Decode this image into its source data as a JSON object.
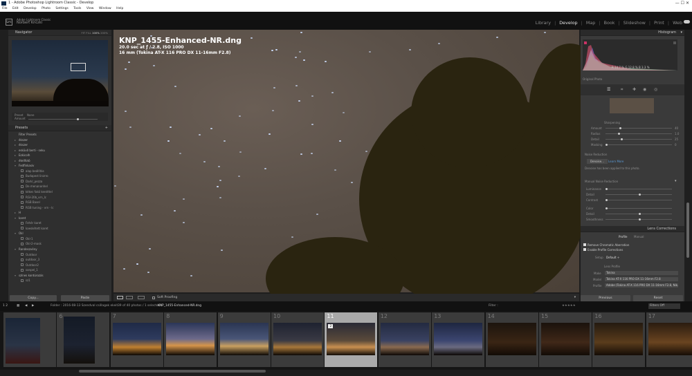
{
  "window": {
    "title": "1 - Adobe Photoshop Lightroom Classic - Develop",
    "controls": "—   ☐   ✕"
  },
  "menu": [
    "File",
    "Edit",
    "Develop",
    "Photo",
    "Settings",
    "Tools",
    "View",
    "Window",
    "Help"
  ],
  "identity": {
    "logo": "Lrc",
    "line1": "Adobe Lightroom Classic",
    "line2": "Norbert Kriczki"
  },
  "modules": {
    "library": "Library",
    "develop": "Develop",
    "map": "Map",
    "book": "Book",
    "slideshow": "Slideshow",
    "print": "Print",
    "web": "Web",
    "sep": "|"
  },
  "navigator": {
    "title": "Navigator",
    "zoom_fit": "FIT",
    "zoom_fill": "FILL",
    "zoom_100": "100%",
    "zoom_200": "200%",
    "preset_tab": "Preset",
    "none_tab": "None",
    "amount": "Amount"
  },
  "presets": {
    "title": "Presets",
    "plus": "+",
    "items": [
      {
        "type": "f",
        "label": "Filter Presets"
      },
      {
        "type": "f",
        "label": "ékszer",
        "arrow": "▸"
      },
      {
        "type": "f",
        "label": "ékszer",
        "arrow": "▸"
      },
      {
        "type": "f",
        "label": "esküvő berti - seku",
        "arrow": "▸"
      },
      {
        "type": "f",
        "label": "Ezkicolh",
        "arrow": "▸"
      },
      {
        "type": "f",
        "label": "étellfotó",
        "arrow": "▸"
      },
      {
        "type": "f",
        "label": "Fedfinkasiv",
        "arrow": "▾"
      },
      {
        "type": "i",
        "label": "alap beállítás"
      },
      {
        "type": "i",
        "label": "Budapest linzrro"
      },
      {
        "type": "i",
        "label": "Darkl_pezza"
      },
      {
        "type": "i",
        "label": "De menanonhel"
      },
      {
        "type": "i",
        "label": "kékes fakó kenéttel"
      },
      {
        "type": "i",
        "label": "RGI-20b_vrn_lc"
      },
      {
        "type": "i",
        "label": "RGB Basel"
      },
      {
        "type": "i",
        "label": "RGB tuning - vrn - lc"
      },
      {
        "type": "f",
        "label": "H",
        "arrow": "▸"
      },
      {
        "type": "f",
        "label": "karet",
        "arrow": "▾"
      },
      {
        "type": "i",
        "label": "Fehér karet"
      },
      {
        "type": "i",
        "label": "kaeskétett karet"
      },
      {
        "type": "f",
        "label": "Okl",
        "arrow": "▾"
      },
      {
        "type": "i",
        "label": "Okl-1"
      },
      {
        "type": "i",
        "label": "Okl-2-mask"
      },
      {
        "type": "f",
        "label": "Randeszvény",
        "arrow": "▾"
      },
      {
        "type": "i",
        "label": "Outdoor"
      },
      {
        "type": "i",
        "label": "outdoor_3"
      },
      {
        "type": "i",
        "label": "Outdoor2"
      },
      {
        "type": "i",
        "label": "sonpel_1"
      },
      {
        "type": "f",
        "label": "színes kontúrozás",
        "arrow": "▾"
      },
      {
        "type": "i",
        "label": "sz1"
      }
    ]
  },
  "left_buttons": {
    "copy": "Copy...",
    "paste": "Paste"
  },
  "photo": {
    "filename": "KNP_1455-Enhanced-NR.dng",
    "exposure": "20.0 sec at ƒ / 2.8, ISO 1000",
    "lens": "16 mm (Tokina AT-X 116 PRO DX 11-16mm F2.8)"
  },
  "toolbar": {
    "soft_proofing": "Soft Proofing"
  },
  "histogram": {
    "title": "Histogram",
    "r_label": "R",
    "r": "14.7",
    "g_label": "G",
    "g": "12.8",
    "b_label": "B",
    "b": "3.3",
    "pct": "%",
    "original": "Original Photo"
  },
  "detail": {
    "sharpening": "Sharpening",
    "amount": "Amount",
    "amount_v": "40",
    "radius": "Radius",
    "radius_v": "1.0",
    "detail": "Detail",
    "detail_v": "25",
    "masking": "Masking",
    "masking_v": "0",
    "nr": "Noise Reduction",
    "nr_denoise": "Denoise...",
    "nr_learn": "Learn More",
    "nr_msg": "Denoise has been applied to this photo.",
    "manual": "Manual Noise Reduction",
    "luminance": "Luminance",
    "lum_detail": "Detail",
    "lum_contrast": "Contrast",
    "color": "Color",
    "color_detail": "Detail",
    "smooth": "Smoothness"
  },
  "lens": {
    "title": "Lens Corrections",
    "profile_tab": "Profile",
    "manual_tab": "Manual",
    "remove_ca": "Remove Chromatic Aberration",
    "enable_profile": "Enable Profile Corrections",
    "setup": "Setup",
    "setup_v": "Default ÷",
    "lens_profile": "Lens Profile",
    "make": "Make",
    "make_v": "Tokina",
    "model": "Model",
    "model_v": "Tokina AT-X 116 PRO DX 11-16mm F2.8",
    "profile": "Profile",
    "profile_v": "Adobe (Tokina AT-X 116 PRO DX 11-16mm F2.8, Nik..."
  },
  "right_buttons": {
    "previous": "Previous",
    "reset": "Reset"
  },
  "filmstrip_bar": {
    "pages": "1  2",
    "folder": "Folder : 2016-08-13 Szendval csillagok ekeit",
    "count": "39 of 40 photos / 1 selected /",
    "current": "KNP_1455-Enhanced-NR.dng",
    "filter": "Filter :",
    "filter_v": "Filters Off",
    "stars": "★★★★★"
  },
  "filmstrip": [
    {
      "num": "",
      "flag": ""
    },
    {
      "num": "6",
      "flag": ""
    },
    {
      "num": "7",
      "flag": ""
    },
    {
      "num": "8",
      "flag": ""
    },
    {
      "num": "9",
      "flag": ""
    },
    {
      "num": "10",
      "flag": ""
    },
    {
      "num": "11",
      "flag": "2"
    },
    {
      "num": "12",
      "flag": ""
    },
    {
      "num": "13",
      "flag": ""
    },
    {
      "num": "14",
      "flag": ""
    },
    {
      "num": "15",
      "flag": ""
    },
    {
      "num": "16",
      "flag": ""
    },
    {
      "num": "17",
      "flag": ""
    }
  ],
  "colors": {
    "accent": "#e6e6e6",
    "selected": "#a9a9a9",
    "link": "#5a9ad6"
  }
}
